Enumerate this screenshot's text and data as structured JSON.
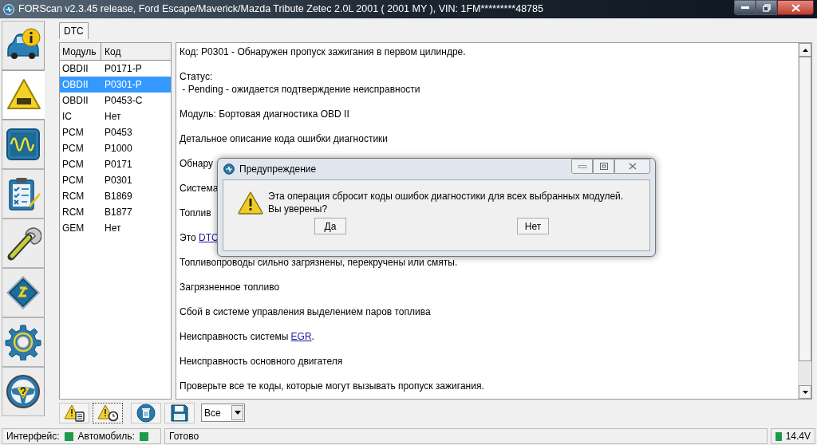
{
  "window": {
    "title": "FORScan v2.3.45 release, Ford Escape/Maverick/Mazda Tribute Zetec 2.0L 2001 ( 2001 MY ), VIN: 1FM*********48785"
  },
  "sidebar": {
    "items": [
      {
        "kind": "vehicle-info",
        "selected": false
      },
      {
        "kind": "dtc",
        "selected": true
      },
      {
        "kind": "oscilloscope",
        "selected": false
      },
      {
        "kind": "checklist",
        "selected": false
      },
      {
        "kind": "wrench",
        "selected": false
      },
      {
        "kind": "chip",
        "selected": false
      },
      {
        "kind": "gear",
        "selected": false
      },
      {
        "kind": "help",
        "selected": false
      }
    ]
  },
  "tabs": [
    {
      "label": "DTC",
      "selected": true
    }
  ],
  "dtc_table": {
    "columns": [
      "Модуль",
      "Код"
    ],
    "rows": [
      {
        "module": "OBDII",
        "code": "P0171-P",
        "selected": false
      },
      {
        "module": "OBDII",
        "code": "P0301-P",
        "selected": true
      },
      {
        "module": "OBDII",
        "code": "P0453-C",
        "selected": false
      },
      {
        "module": "IC",
        "code": "Нет",
        "selected": false
      },
      {
        "module": "PCM",
        "code": "P0453",
        "selected": false
      },
      {
        "module": "PCM",
        "code": "P1000",
        "selected": false
      },
      {
        "module": "PCM",
        "code": "P0171",
        "selected": false
      },
      {
        "module": "PCM",
        "code": "P0301",
        "selected": false
      },
      {
        "module": "RCM",
        "code": "B1869",
        "selected": false
      },
      {
        "module": "RCM",
        "code": "B1877",
        "selected": false
      },
      {
        "module": "GEM",
        "code": "Нет",
        "selected": false
      }
    ]
  },
  "details": {
    "paragraphs": [
      {
        "lines": [
          [
            {
              "text": "Код: P0301 - Обнаружен пропуск зажигания в первом цилиндре.",
              "link": false
            }
          ]
        ]
      },
      {
        "lines": [
          [
            {
              "text": "Статус:",
              "link": false
            }
          ],
          [
            {
              "text": " - Pending - ожидается подтверждение неисправности",
              "link": false
            }
          ]
        ]
      },
      {
        "lines": [
          [
            {
              "text": "Модуль: Бортовая диагностика OBD II",
              "link": false
            }
          ]
        ]
      },
      {
        "lines": [
          [
            {
              "text": "Детальное описание кода ошибки диагностики",
              "link": false
            }
          ]
        ]
      },
      {
        "lines": [
          [
            {
              "text": "Обнару",
              "link": false
            }
          ]
        ]
      },
      {
        "lines": [
          [
            {
              "text": "Система",
              "link": false
            }
          ]
        ]
      },
      {
        "lines": [
          [
            {
              "text": "Топлив",
              "link": false
            }
          ]
        ]
      },
      {
        "lines": [
          [
            {
              "text": "Это ",
              "link": false
            },
            {
              "text": "DTC",
              "link": true
            }
          ]
        ]
      },
      {
        "lines": [
          [
            {
              "text": "Топливопроводы сильно загрязнены, перекручены или смяты.",
              "link": false
            }
          ]
        ]
      },
      {
        "lines": [
          [
            {
              "text": "Загрязненное топливо",
              "link": false
            }
          ]
        ]
      },
      {
        "lines": [
          [
            {
              "text": "Сбой в системе управления выделением паров топлива",
              "link": false
            }
          ]
        ]
      },
      {
        "lines": [
          [
            {
              "text": "Неисправность системы ",
              "link": false
            },
            {
              "text": "EGR",
              "link": true
            },
            {
              "text": ".",
              "link": false
            }
          ]
        ]
      },
      {
        "lines": [
          [
            {
              "text": "Неисправность основного двигателя",
              "link": false
            }
          ]
        ]
      },
      {
        "lines": [
          [
            {
              "text": "Проверьте все те коды, которые могут вызывать пропуск зажигания.",
              "link": false
            }
          ]
        ]
      }
    ]
  },
  "toolbar": {
    "buttons": [
      {
        "kind": "read",
        "focused": false
      },
      {
        "kind": "read-freeze",
        "focused": true
      },
      {
        "kind": "clear",
        "focused": false
      },
      {
        "kind": "save",
        "focused": false
      }
    ],
    "filter": {
      "value": "Все"
    }
  },
  "status_bar": {
    "indicators": [
      {
        "label": "Интерфейс:",
        "color": "#1f9a4a"
      },
      {
        "label": "Автомобиль:",
        "color": "#1f9a4a"
      }
    ],
    "message": "Готово",
    "voltage": {
      "text": "14.4V",
      "color": "#1f9a4a"
    }
  },
  "dialog": {
    "title": "Предупреждение",
    "message_lines": [
      "Эта операция сбросит коды ошибок диагностики для всех выбранных модулей.",
      "Вы уверены?"
    ],
    "buttons": [
      "Да",
      "Нет"
    ]
  }
}
